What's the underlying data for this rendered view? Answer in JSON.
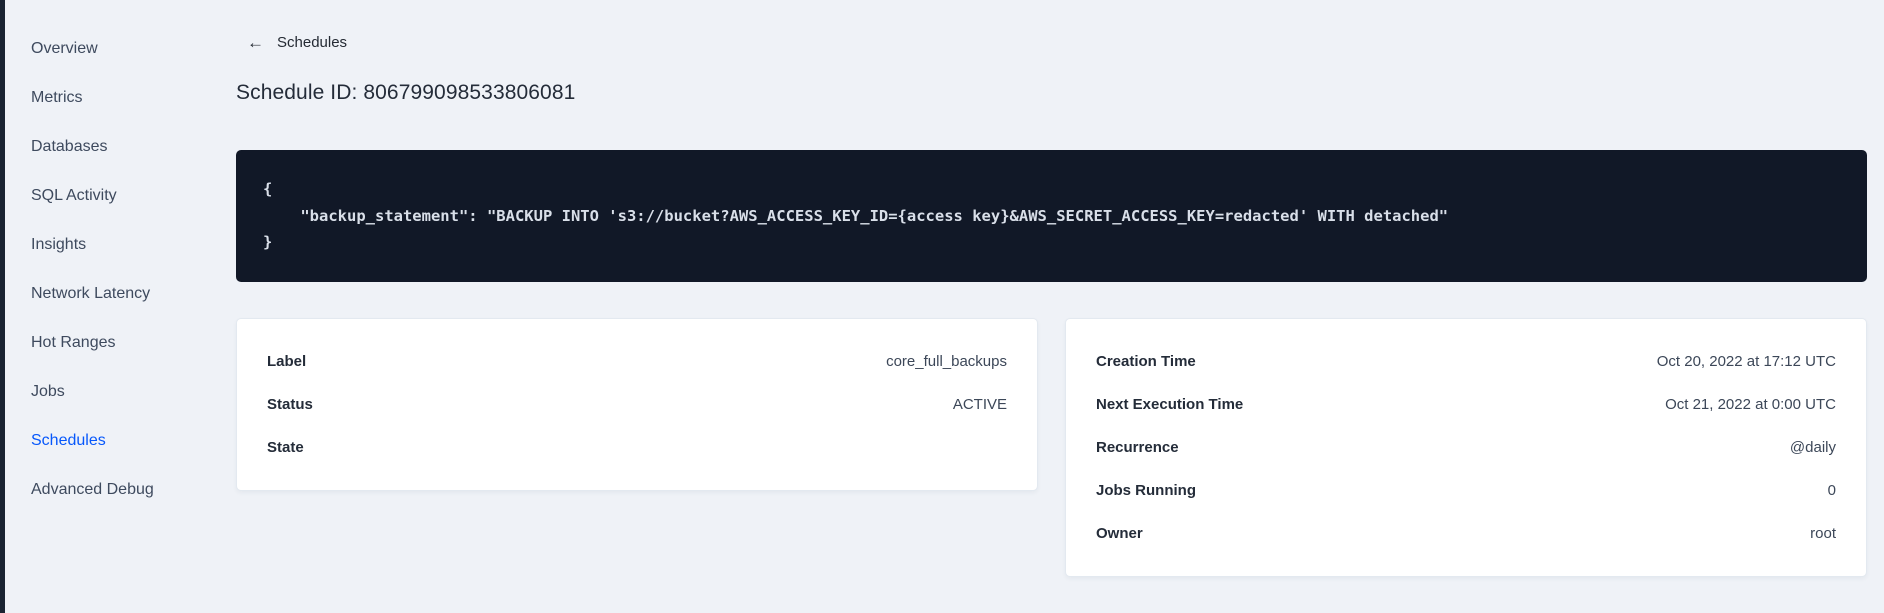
{
  "sidebar": {
    "items": [
      {
        "label": "Overview",
        "active": false
      },
      {
        "label": "Metrics",
        "active": false
      },
      {
        "label": "Databases",
        "active": false
      },
      {
        "label": "SQL Activity",
        "active": false
      },
      {
        "label": "Insights",
        "active": false
      },
      {
        "label": "Network Latency",
        "active": false
      },
      {
        "label": "Hot Ranges",
        "active": false
      },
      {
        "label": "Jobs",
        "active": false
      },
      {
        "label": "Schedules",
        "active": true
      },
      {
        "label": "Advanced Debug",
        "active": false
      }
    ]
  },
  "header": {
    "back_icon": "←",
    "back_label": "Schedules",
    "title": "Schedule ID: 806799098533806081"
  },
  "code_block": {
    "line1": "{",
    "line2": "    \"backup_statement\": \"BACKUP INTO 's3://bucket?AWS_ACCESS_KEY_ID={access key}&AWS_SECRET_ACCESS_KEY=redacted' WITH detached\"",
    "line3": "}"
  },
  "details_card": {
    "rows": [
      {
        "label": "Label",
        "value": "core_full_backups"
      },
      {
        "label": "Status",
        "value": "ACTIVE"
      },
      {
        "label": "State",
        "value": ""
      }
    ]
  },
  "schedule_card": {
    "rows": [
      {
        "label": "Creation Time",
        "value": "Oct 20, 2022 at 17:12 UTC"
      },
      {
        "label": "Next Execution Time",
        "value": "Oct 21, 2022 at 0:00 UTC"
      },
      {
        "label": "Recurrence",
        "value": "@daily"
      },
      {
        "label": "Jobs Running",
        "value": "0"
      },
      {
        "label": "Owner",
        "value": "root"
      }
    ]
  },
  "colors": {
    "accent_blue": "#0657fb",
    "page_bg": "#eff2f7",
    "code_bg": "#111827",
    "code_text": "#d9dfe9",
    "sidebar_text": "#3e4a5e",
    "heading_text": "#242c39",
    "card_bg": "#ffffff",
    "card_border": "#e3e9f0"
  }
}
